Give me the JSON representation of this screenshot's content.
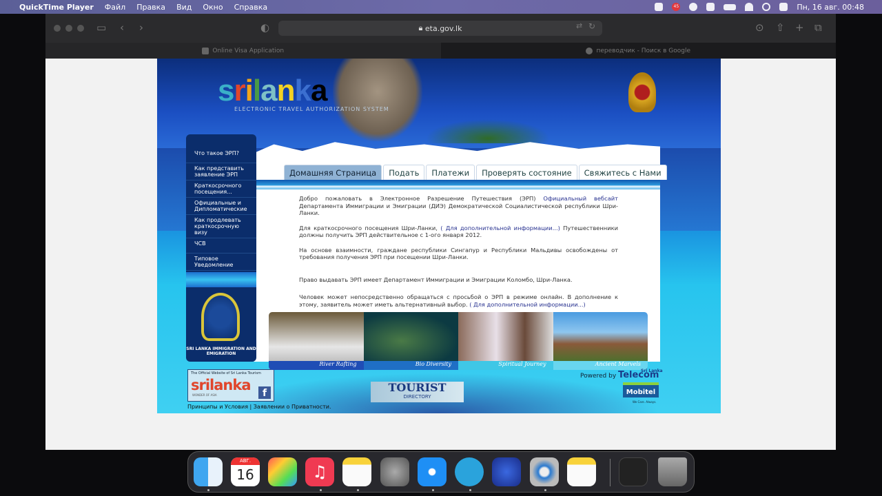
{
  "menubar": {
    "app": "QuickTime Player",
    "items": [
      "Файл",
      "Правка",
      "Вид",
      "Окно",
      "Справка"
    ],
    "badge": "45",
    "datetime": "Пн, 16 авг.  00:48"
  },
  "browser": {
    "url": "eta.gov.lk",
    "tabs": [
      {
        "label": "Online Visa Application",
        "active": false
      },
      {
        "label": "переводчик - Поиск в Google",
        "active": true
      }
    ]
  },
  "site": {
    "logo": "srilanka",
    "logo_subtitle": "ELECTRONIC TRAVEL AUTHORIZATION SYSTEM",
    "sidenav": [
      "Что такое ЭРП?",
      "Как представить заявление ЭРП",
      "Краткосрочного посещения...",
      "Официальные и Дипломатические",
      "Как продлевать краткосрочную визу",
      "ЧСВ",
      "Типовое Уведомление"
    ],
    "immigration_label": "SRI LANKA IMMIGRATION AND EMIGRATION",
    "tabs": [
      "Домашняя Страница",
      "Подать",
      "Платежи",
      "Проверять состояние",
      "Свяжитесь с Нами"
    ],
    "active_tab": "Домашняя Страница",
    "paragraphs": {
      "p1_a": "Добро пожаловать в Электронное Разрешение Путешествия (ЭРП) ",
      "p1_link": "Официальный вебсайт",
      "p1_b": " Департамента Иммиграции и Эмиграции (ДИЭ) Демократической Социалистической республики Шри-Ланки.",
      "p2_a": "Для краткосрочного посещения Шри-Ланки, ",
      "p2_link": "( Для дополнительной информации...)",
      "p2_b": " Путешественники должны получить ЭРП действительное с 1-ого января 2012.",
      "p3": "На основе взаимности, граждане республики Сингапур и Республики Мальдивы освобождены от требования получения ЭРП при посещении Шри-Ланки.",
      "p4": "Право выдавать ЭРП имеет Департамент Иммиграции и Эмиграции Коломбо, Шри-Ланка.",
      "p5_a": "Человек может непосредственно обращаться с просьбой о ЭРП в режиме онлайн. В дополнение к этому, заявитель может иметь альтернативный выбор. ",
      "p5_link": "( Для дополнительной информации...)"
    },
    "photos": [
      "River Rafting",
      "Bio Diversity",
      "Spiritual Journey",
      "Ancient Marvels"
    ],
    "tourism": {
      "caption": "The Official Website of Sri Lanka Tourism",
      "logo": "srilanka",
      "tagline": "WONDER OF ASIA"
    },
    "tourist_directory": {
      "title": "TOURIST",
      "subtitle": "DIRECTORY"
    },
    "powered_by": "Powered by",
    "telecom": "Telecom",
    "telecom_small": "Sri Lanka",
    "mobitel": "Mobitel",
    "mobitel_tag": "We Care. Always.",
    "footer": "Принципы и Условия | Заявлении о Приватности."
  },
  "dock": {
    "calendar_month": "АВГ.",
    "calendar_day": "16"
  }
}
